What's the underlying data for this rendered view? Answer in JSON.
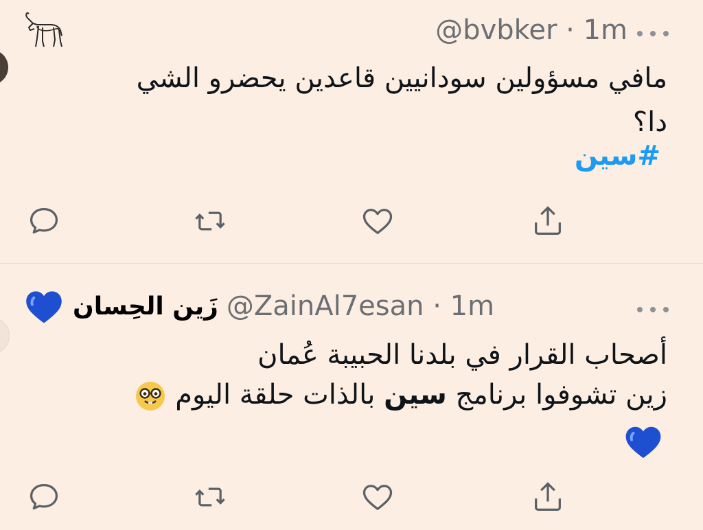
{
  "tweets": [
    {
      "handle": "@bvbker",
      "separator": "·",
      "time": "1m",
      "text_line1": "مافي مسؤولين سودانيين قاعدين يحضرو الشي",
      "text_line2": "دا؟",
      "hashtag": "#سين",
      "header_icon": "ibex-icon",
      "actions": [
        "reply-icon",
        "retweet-icon",
        "like-icon",
        "share-icon"
      ]
    },
    {
      "display_name": "زَين الحِسان",
      "handle": "@ZainAl7esan",
      "separator": "·",
      "time": "1m",
      "text_line1": "أصحاب القرار في بلدنا الحبيبة عُمان",
      "text_line2_part1": "زين تشوفوا برنامج",
      "text_line2_bold": "سين",
      "text_line2_part2": "بالذات حلقة اليوم",
      "name_emoji": "blue-heart-emoji",
      "inline_emoji": "nerd-face-emoji",
      "trailing_emoji": "blue-heart-emoji",
      "actions": [
        "reply-icon",
        "retweet-icon",
        "like-icon",
        "share-icon"
      ]
    }
  ],
  "colors": {
    "background": "#fdeee4",
    "text": "#0f1419",
    "muted": "#6b6f73",
    "hashtag": "#1d9bf0",
    "heart_blue": "#1f4fd1"
  }
}
